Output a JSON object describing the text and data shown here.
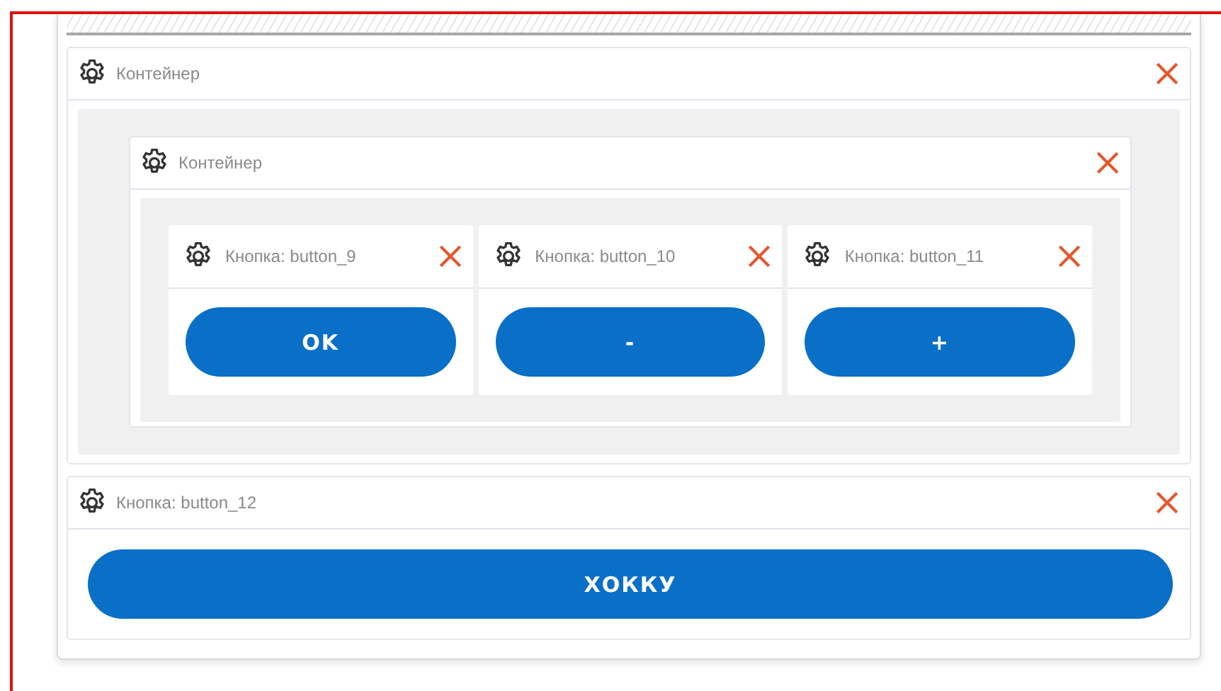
{
  "widgets": [
    {
      "kind": "container",
      "title": "Контейнер",
      "children": [
        {
          "kind": "container",
          "title": "Контейнер",
          "children": [
            {
              "kind": "button",
              "title": "Кнопка: button_9",
              "label": "OK"
            },
            {
              "kind": "button",
              "title": "Кнопка: button_10",
              "label": "-"
            },
            {
              "kind": "button",
              "title": "Кнопка: button_11",
              "label": "+"
            }
          ]
        }
      ]
    },
    {
      "kind": "button",
      "title": "Кнопка: button_12",
      "label": "ХОККУ"
    }
  ]
}
